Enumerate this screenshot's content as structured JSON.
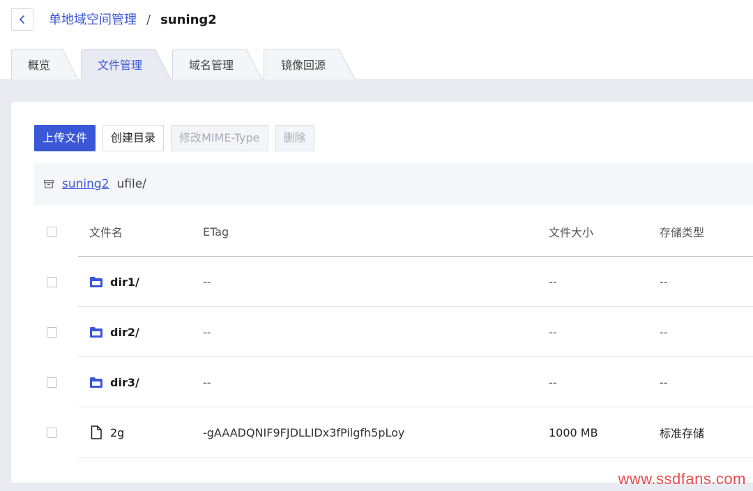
{
  "header": {
    "breadcrumb_parent": "单地域空间管理",
    "breadcrumb_separator": "/",
    "breadcrumb_current": "suning2",
    "back_icon": "chevron-left-icon"
  },
  "tabs": [
    {
      "label": "概览",
      "active": false
    },
    {
      "label": "文件管理",
      "active": true
    },
    {
      "label": "域名管理",
      "active": false
    },
    {
      "label": "镜像回源",
      "active": false
    }
  ],
  "toolbar": {
    "upload_label": "上传文件",
    "mkdir_label": "创建目录",
    "mime_label": "修改MIME-Type",
    "delete_label": "删除"
  },
  "path": {
    "icon": "archive-icon",
    "bucket": "suning2",
    "prefix": "ufile/"
  },
  "table": {
    "columns": [
      "文件名",
      "ETag",
      "文件大小",
      "存储类型"
    ],
    "rows": [
      {
        "type": "folder",
        "name": "dir1/",
        "etag": "--",
        "size": "--",
        "storage": "--"
      },
      {
        "type": "folder",
        "name": "dir2/",
        "etag": "--",
        "size": "--",
        "storage": "--"
      },
      {
        "type": "folder",
        "name": "dir3/",
        "etag": "--",
        "size": "--",
        "storage": "--"
      },
      {
        "type": "file",
        "name": "2g",
        "etag": "-gAAADQNIF9FJDLLIDx3fPilgfh5pLoy",
        "size": "1000 MB",
        "storage": "标准存储"
      }
    ]
  },
  "colors": {
    "accent": "#3a57d6",
    "page_bg": "#e9eaf2"
  },
  "watermark": "www.ssdfans.com"
}
